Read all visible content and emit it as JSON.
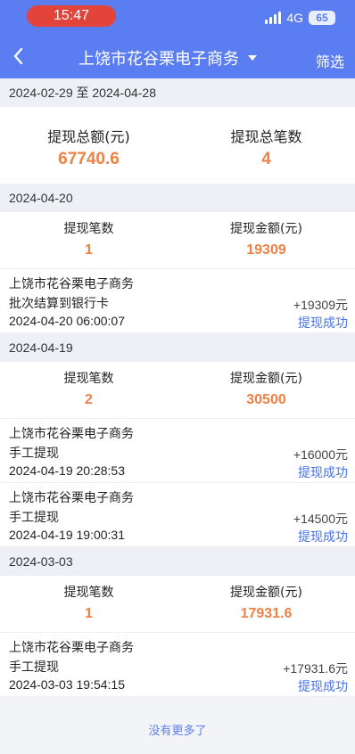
{
  "status": {
    "time": "15:47",
    "network": "4G",
    "battery": "65"
  },
  "nav": {
    "title": "上饶市花谷栗电子商务",
    "filter_label": "筛选"
  },
  "range": {
    "label": "2024-02-29 至 2024-04-28"
  },
  "totals": {
    "amount_label": "提现总额(元)",
    "amount": "67740.6",
    "count_label": "提现总笔数",
    "count": "4"
  },
  "groups": [
    {
      "date": "2024-04-20",
      "count_label": "提现笔数",
      "count": "1",
      "amount_label": "提现金额(元)",
      "amount": "19309",
      "records": [
        {
          "merchant": "上饶市花谷栗电子商务",
          "type": "批次结算到银行卡",
          "time": "2024-04-20 06:00:07",
          "amount": "+19309元",
          "status": "提现成功"
        }
      ]
    },
    {
      "date": "2024-04-19",
      "count_label": "提现笔数",
      "count": "2",
      "amount_label": "提现金额(元)",
      "amount": "30500",
      "records": [
        {
          "merchant": "上饶市花谷栗电子商务",
          "type": "手工提现",
          "time": "2024-04-19 20:28:53",
          "amount": "+16000元",
          "status": "提现成功"
        },
        {
          "merchant": "上饶市花谷栗电子商务",
          "type": "手工提现",
          "time": "2024-04-19 19:00:31",
          "amount": "+14500元",
          "status": "提现成功"
        }
      ]
    },
    {
      "date": "2024-03-03",
      "count_label": "提现笔数",
      "count": "1",
      "amount_label": "提现金额(元)",
      "amount": "17931.6",
      "records": [
        {
          "merchant": "上饶市花谷栗电子商务",
          "type": "手工提现",
          "time": "2024-03-03 19:54:15",
          "amount": "+17931.6元",
          "status": "提现成功"
        }
      ]
    }
  ],
  "footer": {
    "text": "没有更多了"
  },
  "icons": {
    "back": "chevron-left-icon",
    "caret": "caret-down-icon"
  },
  "colors": {
    "header": "#5b7df2",
    "accent_orange": "#ee8245",
    "status_blue": "#4a72e3",
    "time_pill": "#e2433b"
  }
}
